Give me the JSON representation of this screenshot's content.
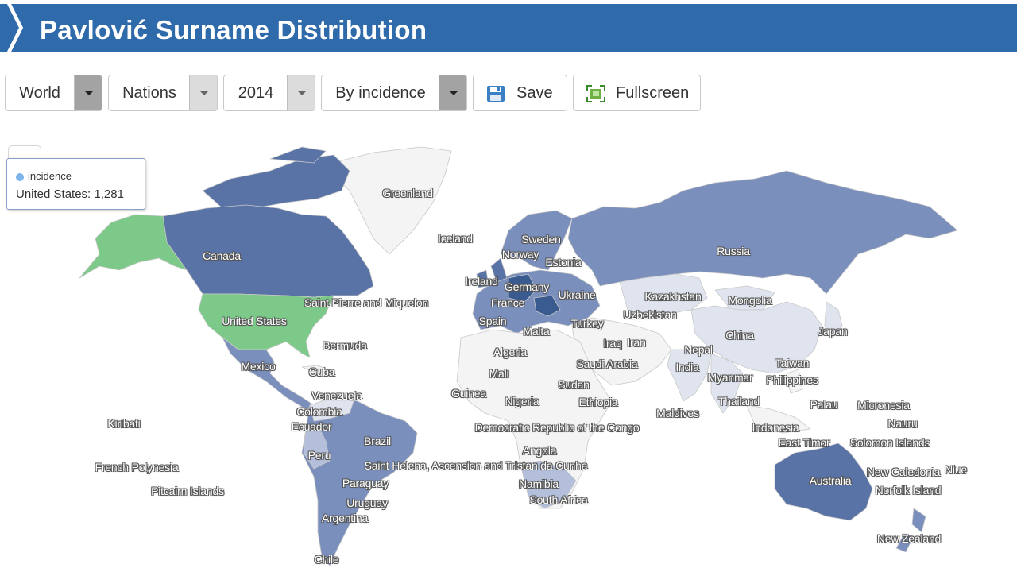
{
  "header": {
    "title": "Pavlović Surname Distribution",
    "color": "#2f6aab"
  },
  "toolbar": {
    "region": "World",
    "level": "Nations",
    "year": "2014",
    "metric": "By incidence",
    "save": "Save",
    "fullscreen": "Fullscreen",
    "icons": {
      "save": "floppy-disk-icon",
      "fullscreen": "fullscreen-icon"
    }
  },
  "tooltip": {
    "series": "incidence",
    "text": "United States: 1,281"
  },
  "map": {
    "colors": {
      "highlight": "#7dc98a",
      "darkest": "#3a5b8f",
      "dark": "#5973a6",
      "medium": "#7b8fbc",
      "light": "#b3bfdb",
      "lightest": "#dfe4ef",
      "none": "#f4f4f4"
    },
    "labels": {
      "greenland": "Greenland",
      "iceland": "Iceland",
      "sweden": "Sweden",
      "norway": "Norway",
      "estonia": "Estonia",
      "russia": "Russia",
      "canada": "Canada",
      "ireland": "Ireland",
      "germany": "Germany",
      "ukraine": "Ukraine",
      "france": "France",
      "spain": "Spain",
      "malta": "Malta",
      "turkey": "Turkey",
      "kazakhstan": "Kazakhstan",
      "mongolia": "Mongolia",
      "uzbekistan": "Uzbekistan",
      "spm": "Saint Pierre and Miquelon",
      "us": "United States",
      "bermuda": "Bermuda",
      "algeria": "Algeria",
      "iraq": "Iraq",
      "iran": "Iran",
      "china": "China",
      "japan": "Japan",
      "nepal": "Nepal",
      "india": "India",
      "mexico": "Mexico",
      "cuba": "Cuba",
      "saudi": "Saudi Arabia",
      "taiwan": "Taiwan",
      "myanmar": "Myanmar",
      "philippines": "Philippines",
      "mali": "Mali",
      "sudan": "Sudan",
      "venezuela": "Venezuela",
      "guinea": "Guinea",
      "nigeria": "Nigeria",
      "ethiopia": "Ethiopia",
      "thailand": "Thailand",
      "palau": "Palau",
      "micronesia": "Micronesia",
      "colombia": "Colombia",
      "kiribati": "Kiribati",
      "maldives": "Maldives",
      "ecuador": "Ecuador",
      "drc": "Democratic Republic of the Congo",
      "indonesia": "Indonesia",
      "nauru": "Nauru",
      "brazil": "Brazil",
      "easttimor": "East Timor",
      "solomon": "Solomon Islands",
      "angola": "Angola",
      "peru": "Peru",
      "frpoly": "French Polynesia",
      "sthelena": "Saint Helena, Ascension and Tristan da Cunha",
      "newcal": "New Caledonia",
      "niue": "Niue",
      "australia": "Australia",
      "paraguay": "Paraguay",
      "namibia": "Namibia",
      "pitcairn": "Pitcairn Islands",
      "norfolk": "Norfolk Island",
      "southafrica": "South Africa",
      "uruguay": "Uruguay",
      "argentina": "Argentina",
      "nz": "New Zealand",
      "chile": "Chile"
    }
  }
}
